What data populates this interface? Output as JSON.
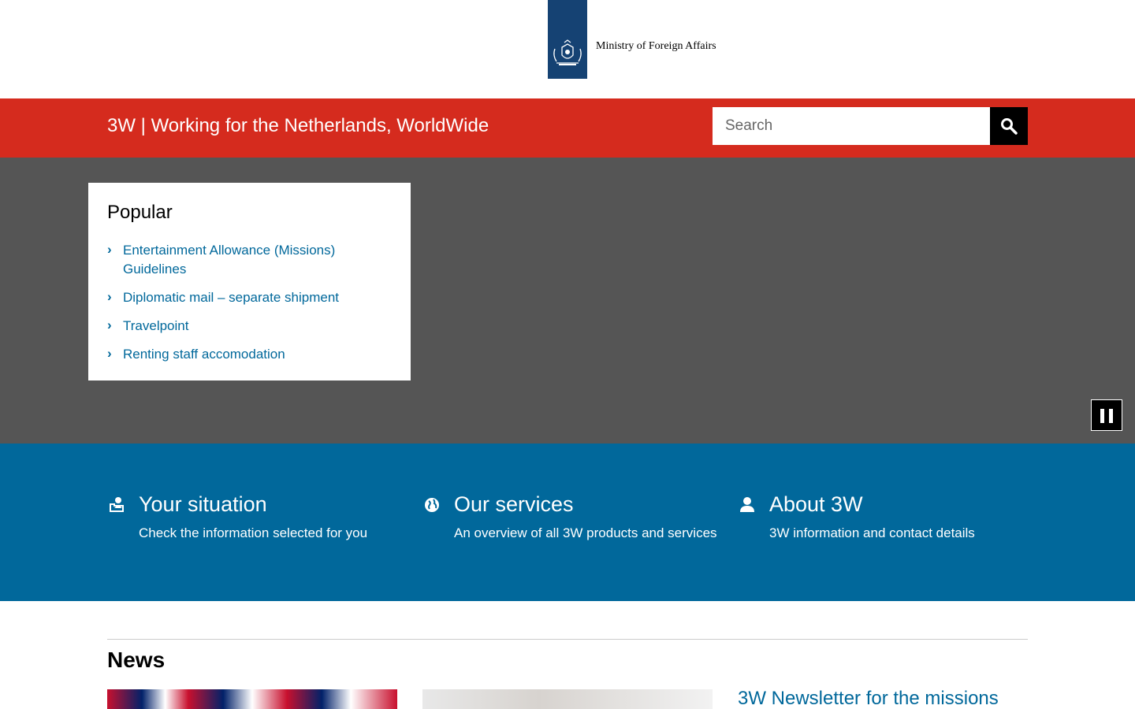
{
  "header": {
    "organisation": "Ministry of Foreign Affairs"
  },
  "banner": {
    "title": "3W | Working for the Netherlands, WorldWide",
    "search_placeholder": "Search",
    "search_button_icon": "search-icon"
  },
  "popular": {
    "heading": "Popular",
    "items": [
      {
        "label": "Entertainment Allowance (Missions) Guidelines"
      },
      {
        "label": "Diplomatic mail – separate shipment"
      },
      {
        "label": "Travelpoint"
      },
      {
        "label": "Renting staff accomodation"
      }
    ],
    "pause_icon": "pause-icon"
  },
  "tiles": [
    {
      "icon": "user-situation-icon",
      "title": "Your situation",
      "description": "Check the information selected for you"
    },
    {
      "icon": "globe-icon",
      "title": "Our services",
      "description": "An overview of all 3W products and services"
    },
    {
      "icon": "person-icon",
      "title": "About 3W",
      "description": "3W information and contact details"
    }
  ],
  "news": {
    "heading": "News",
    "items": [
      {
        "title": "3W Newsletter for the missions"
      }
    ]
  },
  "colors": {
    "logo_blue": "#154273",
    "banner_red": "#d52b1e",
    "hero_grey": "#555555",
    "tiles_blue": "#01689b",
    "link_blue": "#01689b"
  }
}
